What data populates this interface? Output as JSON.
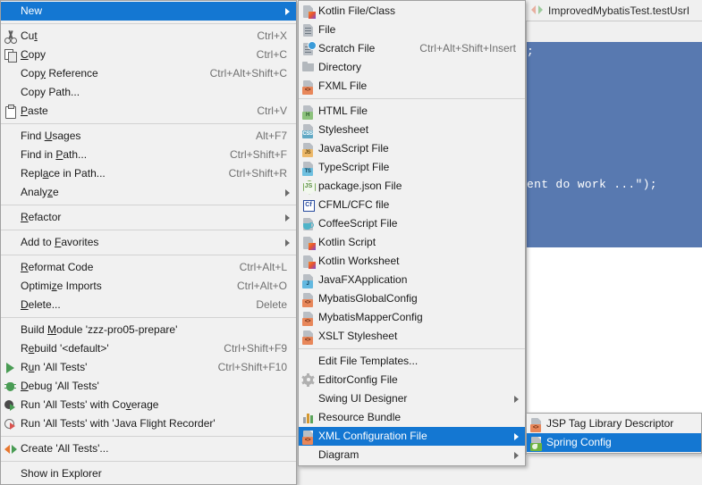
{
  "background": {
    "tab_title": "ImprovedMybatisTest.testUsrI",
    "tab_icon": "run-test-icon",
    "editor_selected_fragment": ";",
    "editor_selected_text": "ent do work ...\");"
  },
  "context_menu": {
    "items": [
      {
        "label": "New",
        "accel": "",
        "icon": "",
        "arrow": true,
        "selected": true
      },
      {
        "sep": true
      },
      {
        "label": "Cut",
        "accel": "Ctrl+X",
        "icon": "cut-icon",
        "mnemonic": "t"
      },
      {
        "label": "Copy",
        "accel": "Ctrl+C",
        "icon": "copy-icon",
        "mnemonic": "C"
      },
      {
        "label": "Copy Reference",
        "accel": "Ctrl+Alt+Shift+C",
        "icon": "",
        "mnemonic": "y"
      },
      {
        "label": "Copy Path...",
        "accel": "",
        "icon": ""
      },
      {
        "label": "Paste",
        "accel": "Ctrl+V",
        "icon": "paste-icon",
        "mnemonic": "P"
      },
      {
        "sep": true
      },
      {
        "label": "Find Usages",
        "accel": "Alt+F7",
        "icon": "",
        "mnemonic": "U"
      },
      {
        "label": "Find in Path...",
        "accel": "Ctrl+Shift+F",
        "icon": "",
        "mnemonic": "P"
      },
      {
        "label": "Replace in Path...",
        "accel": "Ctrl+Shift+R",
        "icon": "",
        "mnemonic": "a"
      },
      {
        "label": "Analyze",
        "accel": "",
        "icon": "",
        "arrow": true,
        "mnemonic": "z"
      },
      {
        "sep": true
      },
      {
        "label": "Refactor",
        "accel": "",
        "icon": "",
        "arrow": true,
        "mnemonic": "R"
      },
      {
        "sep": true
      },
      {
        "label": "Add to Favorites",
        "accel": "",
        "icon": "",
        "arrow": true,
        "mnemonic": "F"
      },
      {
        "sep": true
      },
      {
        "label": "Reformat Code",
        "accel": "Ctrl+Alt+L",
        "icon": "",
        "mnemonic": "R"
      },
      {
        "label": "Optimize Imports",
        "accel": "Ctrl+Alt+O",
        "icon": "",
        "mnemonic": "z"
      },
      {
        "label": "Delete...",
        "accel": "Delete",
        "icon": "",
        "mnemonic": "D"
      },
      {
        "sep": true
      },
      {
        "label": "Build Module 'zzz-pro05-prepare'",
        "accel": "",
        "icon": "",
        "mnemonic": "M"
      },
      {
        "label": "Rebuild '<default>'",
        "accel": "Ctrl+Shift+F9",
        "icon": "",
        "mnemonic": "e"
      },
      {
        "label": "Run 'All Tests'",
        "accel": "Ctrl+Shift+F10",
        "icon": "run-icon",
        "mnemonic": "u"
      },
      {
        "label": "Debug 'All Tests'",
        "accel": "",
        "icon": "debug-icon",
        "mnemonic": "D"
      },
      {
        "label": "Run 'All Tests' with Coverage",
        "accel": "",
        "icon": "coverage-icon",
        "mnemonic": "v"
      },
      {
        "label": "Run 'All Tests' with 'Java Flight Recorder'",
        "accel": "",
        "icon": "jfr-icon"
      },
      {
        "sep": true
      },
      {
        "label": "Create 'All Tests'...",
        "accel": "",
        "icon": "create-icon"
      },
      {
        "sep": true
      },
      {
        "label": "Show in Explorer",
        "accel": "",
        "icon": ""
      }
    ]
  },
  "new_menu": {
    "items": [
      {
        "label": "Kotlin File/Class",
        "accel": "",
        "icon": "kotlin-file-icon"
      },
      {
        "label": "File",
        "accel": "",
        "icon": "file-icon"
      },
      {
        "label": "Scratch File",
        "accel": "Ctrl+Alt+Shift+Insert",
        "icon": "scratch-file-icon"
      },
      {
        "label": "Directory",
        "accel": "",
        "icon": "directory-icon"
      },
      {
        "label": "FXML File",
        "accel": "",
        "icon": "fxml-file-icon"
      },
      {
        "sep": true
      },
      {
        "label": "HTML File",
        "accel": "",
        "icon": "html-file-icon"
      },
      {
        "label": "Stylesheet",
        "accel": "",
        "icon": "css-file-icon"
      },
      {
        "label": "JavaScript File",
        "accel": "",
        "icon": "js-file-icon"
      },
      {
        "label": "TypeScript File",
        "accel": "",
        "icon": "ts-file-icon"
      },
      {
        "label": "package.json File",
        "accel": "",
        "icon": "node-package-icon"
      },
      {
        "label": "CFML/CFC file",
        "accel": "",
        "icon": "cfml-file-icon"
      },
      {
        "label": "CoffeeScript File",
        "accel": "",
        "icon": "coffeescript-file-icon"
      },
      {
        "label": "Kotlin Script",
        "accel": "",
        "icon": "kotlin-script-icon"
      },
      {
        "label": "Kotlin Worksheet",
        "accel": "",
        "icon": "kotlin-worksheet-icon"
      },
      {
        "label": "JavaFXApplication",
        "accel": "",
        "icon": "javafx-file-icon"
      },
      {
        "label": "MybatisGlobalConfig",
        "accel": "",
        "icon": "xml-file-icon"
      },
      {
        "label": "MybatisMapperConfig",
        "accel": "",
        "icon": "xml-file-icon"
      },
      {
        "label": "XSLT Stylesheet",
        "accel": "",
        "icon": "xml-file-icon"
      },
      {
        "sep": true
      },
      {
        "label": "Edit File Templates...",
        "accel": "",
        "icon": ""
      },
      {
        "label": "EditorConfig File",
        "accel": "",
        "icon": "gear-icon"
      },
      {
        "label": "Swing UI Designer",
        "accel": "",
        "icon": "",
        "arrow": true
      },
      {
        "label": "Resource Bundle",
        "accel": "",
        "icon": "resource-bundle-icon"
      },
      {
        "label": "XML Configuration File",
        "accel": "",
        "icon": "xml-file-icon",
        "arrow": true,
        "selected": true
      },
      {
        "label": "Diagram",
        "accel": "",
        "icon": "",
        "arrow": true
      }
    ]
  },
  "xml_config_menu": {
    "items": [
      {
        "label": "JSP Tag Library Descriptor",
        "accel": "",
        "icon": "xml-file-icon"
      },
      {
        "label": "Spring Config",
        "accel": "",
        "icon": "spring-config-icon",
        "selected": true
      }
    ]
  },
  "colors": {
    "selection": "#1477d2",
    "menu_bg": "#f1f1f1",
    "menu_border": "#a0a0a0",
    "accel_text": "#707070",
    "editor_selection": "#5879b0"
  }
}
